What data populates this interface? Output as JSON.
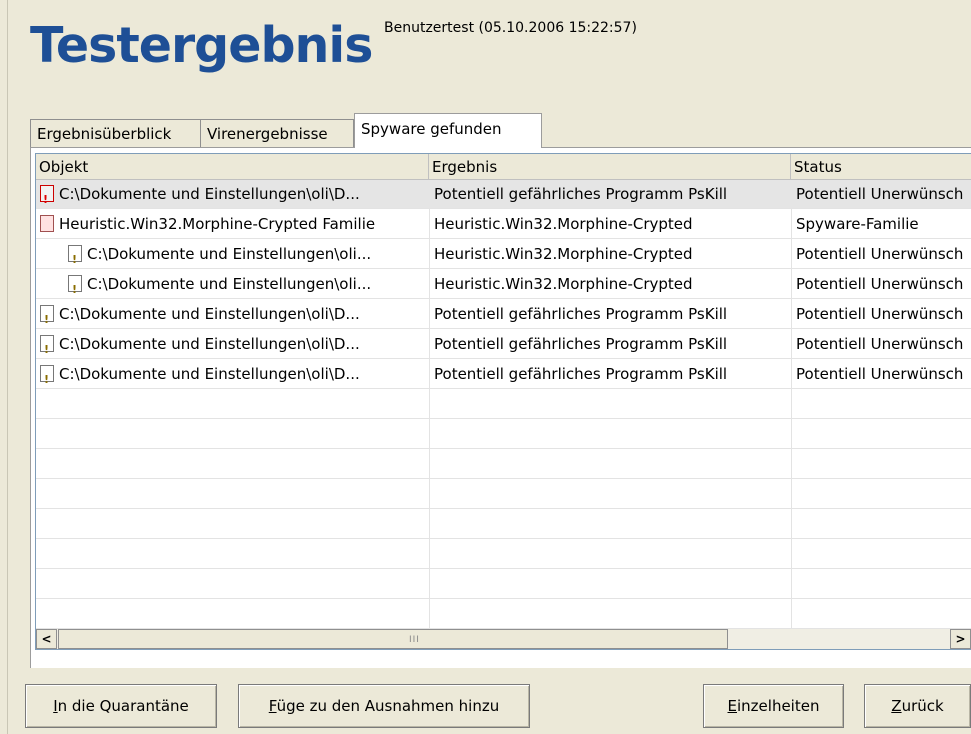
{
  "header": {
    "title": "Testergebnis",
    "subtitle": "Benutzertest (05.10.2006 15:22:57)"
  },
  "tabs": [
    {
      "label": "Ergebnisüberblick",
      "active": false
    },
    {
      "label": "Virenergebnisse",
      "active": false
    },
    {
      "label": "Spyware gefunden",
      "active": true
    }
  ],
  "table": {
    "columns": [
      "Objekt",
      "Ergebnis",
      "Status"
    ],
    "rows": [
      {
        "icon": "red-alert-file-icon",
        "indent": false,
        "selected": true,
        "objekt": "C:\\Dokumente und Einstellungen\\oli\\D...",
        "ergebnis": "Potentiell gefährliches Programm PsKill",
        "status": "Potentiell Unerwünsch"
      },
      {
        "icon": "spyware-family-icon",
        "indent": false,
        "selected": false,
        "objekt": "Heuristic.Win32.Morphine-Crypted Familie",
        "ergebnis": "Heuristic.Win32.Morphine-Crypted",
        "status": "Spyware-Familie"
      },
      {
        "icon": "warning-file-icon",
        "indent": true,
        "selected": false,
        "objekt": "C:\\Dokumente und Einstellungen\\oli...",
        "ergebnis": "Heuristic.Win32.Morphine-Crypted",
        "status": "Potentiell Unerwünsch"
      },
      {
        "icon": "warning-file-icon",
        "indent": true,
        "selected": false,
        "objekt": "C:\\Dokumente und Einstellungen\\oli...",
        "ergebnis": "Heuristic.Win32.Morphine-Crypted",
        "status": "Potentiell Unerwünsch"
      },
      {
        "icon": "warning-file-icon",
        "indent": false,
        "selected": false,
        "objekt": "C:\\Dokumente und Einstellungen\\oli\\D...",
        "ergebnis": "Potentiell gefährliches Programm PsKill",
        "status": "Potentiell Unerwünsch"
      },
      {
        "icon": "warning-file-icon",
        "indent": false,
        "selected": false,
        "objekt": "C:\\Dokumente und Einstellungen\\oli\\D...",
        "ergebnis": "Potentiell gefährliches Programm PsKill",
        "status": "Potentiell Unerwünsch"
      },
      {
        "icon": "warning-file-icon",
        "indent": false,
        "selected": false,
        "objekt": "C:\\Dokumente und Einstellungen\\oli\\D...",
        "ergebnis": "Potentiell gefährliches Programm PsKill",
        "status": "Potentiell Unerwünsch"
      }
    ]
  },
  "scrollbar": {
    "left_arrow": "<",
    "right_arrow": ">",
    "grip": "III"
  },
  "buttons": {
    "quarantine": {
      "prefix": "",
      "mnemonic": "I",
      "rest": "n die Quarantäne"
    },
    "exceptions": {
      "prefix": "",
      "mnemonic": "F",
      "rest": "üge zu den Ausnahmen hinzu"
    },
    "details": {
      "prefix": "",
      "mnemonic": "E",
      "rest": "inzelheiten"
    },
    "back": {
      "prefix": "",
      "mnemonic": "Z",
      "rest": "urück"
    }
  },
  "colors": {
    "title": "#1e4f96",
    "background": "#ece9d8",
    "selected_row": "#e5e5e5"
  }
}
